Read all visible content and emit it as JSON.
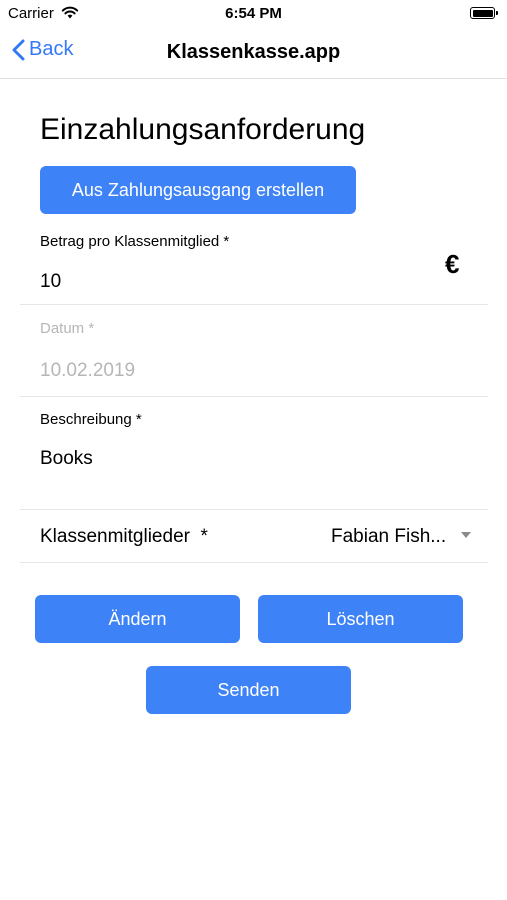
{
  "status_bar": {
    "carrier": "Carrier",
    "time": "6:54 PM"
  },
  "nav": {
    "back_label": "Back",
    "title": "Klassenkasse.app"
  },
  "page": {
    "heading": "Einzahlungsanforderung",
    "create_button": "Aus Zahlungsausgang erstellen"
  },
  "form": {
    "amount": {
      "label": "Betrag pro Klassenmitglied *",
      "value": "10",
      "currency": "€"
    },
    "date": {
      "label": "Datum *",
      "value": "10.02.2019"
    },
    "description": {
      "label": "Beschreibung *",
      "value": "Books"
    },
    "members": {
      "label": "Klassenmitglieder  *",
      "value": "Fabian Fish..."
    }
  },
  "actions": {
    "change": "Ändern",
    "delete": "Löschen",
    "send": "Senden"
  },
  "colors": {
    "accent": "#3d82f7",
    "link": "#3478f6",
    "disabled_text": "#b6b6b6"
  }
}
